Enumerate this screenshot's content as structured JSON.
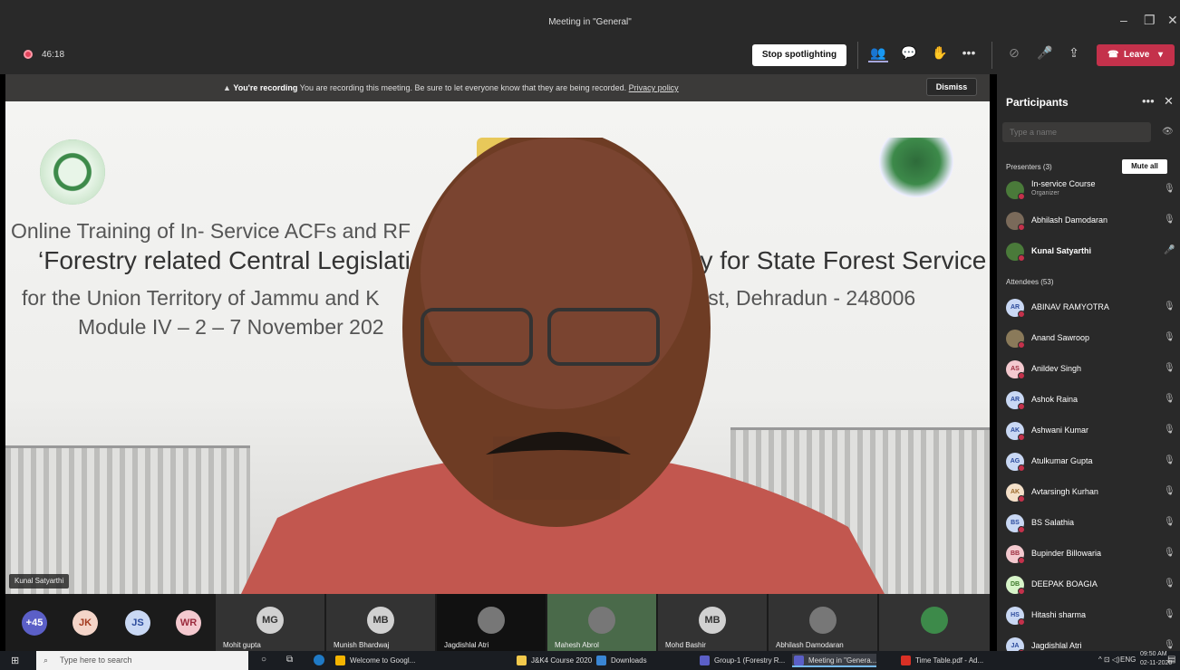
{
  "window": {
    "title": "Meeting in \"General\"",
    "minimize": "–",
    "restore": "❐",
    "close": "✕"
  },
  "toolbar": {
    "timer": "46:18",
    "stop_spotlight": "Stop spotlighting",
    "leave": "Leave",
    "icons": [
      "people-icon",
      "chat-icon",
      "raise-hand-icon",
      "more-icon",
      "camera-off-icon",
      "mic-off-icon",
      "share-icon",
      "phone-icon",
      "chevron-down-icon"
    ]
  },
  "banner": {
    "bold": "You're recording",
    "text": "You are recording this meeting. Be sure to let everyone know that they are being recorded.",
    "link": "Privacy policy",
    "dismiss": "Dismiss"
  },
  "slide": {
    "line1": "Online Training of In- Service ACFs and RF",
    "line2a": "‘Forestry related Central Legislati",
    "line2b": "demy for State Forest Service",
    "line3a": "for the Union Territory of Jammu and K",
    "line3b": "Forest, Dehradun - 248006",
    "line4": "Module IV – 2 – 7 November 202"
  },
  "speaker_tag": "Kunal Satyarthi",
  "strip": {
    "avatars": [
      {
        "initials": "+45",
        "bg": "#5b5fc7",
        "fg": "#fff"
      },
      {
        "initials": "JK",
        "bg": "#f4d5c9",
        "fg": "#a33a1f"
      },
      {
        "initials": "JS",
        "bg": "#c9d8f4",
        "fg": "#2c4b9c"
      },
      {
        "initials": "WR",
        "bg": "#f4c9cf",
        "fg": "#9c2c3e"
      }
    ],
    "tiles": [
      {
        "initials": "MG",
        "name": "Mohit gupta"
      },
      {
        "initials": "MB",
        "name": "Munish Bhardwaj"
      },
      {
        "initials": "",
        "name": "Jagdishlal Atri"
      },
      {
        "initials": "",
        "name": "Mahesh Abrol"
      },
      {
        "initials": "MB",
        "name": "Mohd Bashir"
      },
      {
        "initials": "",
        "name": "Abhilash Damodaran"
      },
      {
        "initials": "",
        "name": ""
      }
    ]
  },
  "participants": {
    "title": "Participants",
    "search_placeholder": "Type a name",
    "presenters_label": "Presenters (3)",
    "mute_all": "Mute all",
    "attendees_label": "Attendees (53)",
    "presenters": [
      {
        "name": "In-service Course",
        "role": "Organizer",
        "initials": "",
        "bg": "#4a7a3a"
      },
      {
        "name": "Abhilash Damodaran",
        "role": "",
        "initials": "",
        "bg": "#7a6a5a"
      },
      {
        "name": "Kunal Satyarthi",
        "role": "",
        "initials": "",
        "bg": "#4a7a3a"
      }
    ],
    "attendees": [
      {
        "name": "ABINAV RAMYOTRA",
        "initials": "AR",
        "bg": "#c9d8f4",
        "fg": "#2c4b9c"
      },
      {
        "name": "Anand Sawroop",
        "initials": "",
        "bg": "#8a7a5a",
        "fg": "#fff"
      },
      {
        "name": "Anildev Singh",
        "initials": "AS",
        "bg": "#f4c9cf",
        "fg": "#9c2c3e"
      },
      {
        "name": "Ashok Raina",
        "initials": "AR",
        "bg": "#c9d8f4",
        "fg": "#2c4b9c"
      },
      {
        "name": "Ashwani Kumar",
        "initials": "AK",
        "bg": "#c9d8f4",
        "fg": "#2c4b9c"
      },
      {
        "name": "Atulkumar Gupta",
        "initials": "AG",
        "bg": "#c9d8f4",
        "fg": "#2c4b9c"
      },
      {
        "name": "Avtarsingh Kurhan",
        "initials": "AK",
        "bg": "#f4e0c9",
        "fg": "#9c6a2c"
      },
      {
        "name": "BS Salathia",
        "initials": "BS",
        "bg": "#c9d8f4",
        "fg": "#2c4b9c"
      },
      {
        "name": "Bupinder Billowaria",
        "initials": "BB",
        "bg": "#f4c9cf",
        "fg": "#9c2c3e"
      },
      {
        "name": "DEEPAK BOAGIA",
        "initials": "DB",
        "bg": "#d7f4c9",
        "fg": "#3e7a2c"
      },
      {
        "name": "Hitashi sharma",
        "initials": "HS",
        "bg": "#c9d8f4",
        "fg": "#2c4b9c"
      },
      {
        "name": "Jagdishlal Atri",
        "initials": "JA",
        "bg": "#c9d8f4",
        "fg": "#2c4b9c"
      }
    ]
  },
  "taskbar": {
    "search": "Type here to search",
    "apps": [
      {
        "label": "Welcome to Googl...",
        "color": "#f4b400"
      },
      {
        "label": "J&K4 Course 2020",
        "color": "#f2c94c"
      },
      {
        "label": "Downloads",
        "color": "#3a86d4"
      },
      {
        "label": "Group-1 (Forestry R...",
        "color": "#5b5fc7"
      },
      {
        "label": "Meeting in \"Genera...",
        "color": "#5b5fc7"
      },
      {
        "label": "Time Table.pdf - Ad...",
        "color": "#d93025"
      }
    ],
    "lang": "ENG",
    "time": "09:50 AM",
    "date": "02-11-2020"
  }
}
